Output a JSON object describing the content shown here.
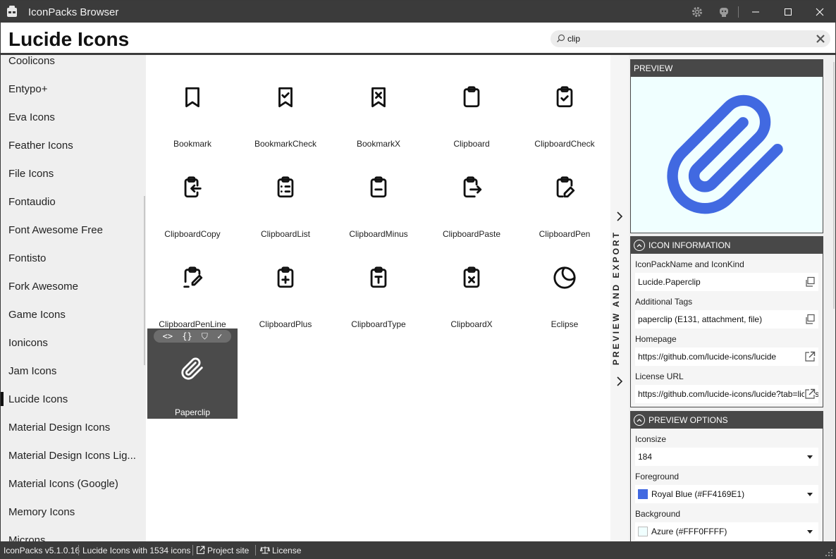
{
  "window": {
    "title": "IconPacks Browser"
  },
  "header": {
    "page_title": "Lucide Icons"
  },
  "search": {
    "value": "clip",
    "placeholder": ""
  },
  "sidebar": {
    "items": [
      {
        "label": "Coolicons"
      },
      {
        "label": "Entypo+"
      },
      {
        "label": "Eva Icons"
      },
      {
        "label": "Feather Icons"
      },
      {
        "label": "File Icons"
      },
      {
        "label": "Fontaudio"
      },
      {
        "label": "Font Awesome Free"
      },
      {
        "label": "Fontisto"
      },
      {
        "label": "Fork Awesome"
      },
      {
        "label": "Game Icons"
      },
      {
        "label": "Ionicons"
      },
      {
        "label": "Jam Icons"
      },
      {
        "label": "Lucide Icons",
        "active": true
      },
      {
        "label": "Material Design Icons"
      },
      {
        "label": "Material Design Icons Lig..."
      },
      {
        "label": "Material Icons (Google)"
      },
      {
        "label": "Memory Icons"
      },
      {
        "label": "Microns"
      }
    ]
  },
  "icons": [
    {
      "label": "Bookmark",
      "icon": "bookmark-icon"
    },
    {
      "label": "BookmarkCheck",
      "icon": "bookmark-check-icon"
    },
    {
      "label": "BookmarkX",
      "icon": "bookmark-x-icon"
    },
    {
      "label": "Clipboard",
      "icon": "clipboard-icon"
    },
    {
      "label": "ClipboardCheck",
      "icon": "clipboard-check-icon"
    },
    {
      "label": "ClipboardCopy",
      "icon": "clipboard-copy-icon"
    },
    {
      "label": "ClipboardList",
      "icon": "clipboard-list-icon"
    },
    {
      "label": "ClipboardMinus",
      "icon": "clipboard-minus-icon"
    },
    {
      "label": "ClipboardPaste",
      "icon": "clipboard-paste-icon"
    },
    {
      "label": "ClipboardPen",
      "icon": "clipboard-pen-icon"
    },
    {
      "label": "ClipboardPenLine",
      "icon": "clipboard-pen-line-icon"
    },
    {
      "label": "ClipboardPlus",
      "icon": "clipboard-plus-icon"
    },
    {
      "label": "ClipboardType",
      "icon": "clipboard-type-icon"
    },
    {
      "label": "ClipboardX",
      "icon": "clipboard-x-icon"
    },
    {
      "label": "Eclipse",
      "icon": "eclipse-icon"
    },
    {
      "label": "Paperclip",
      "icon": "paperclip-icon",
      "selected": true
    }
  ],
  "tile_tools": {
    "xaml": "<>",
    "json": "{}",
    "svg": "⛉",
    "copy": "✓"
  },
  "strip": {
    "label": "PREVIEW AND EXPORT"
  },
  "preview": {
    "header": "PREVIEW",
    "foreground": "#4169E1",
    "background": "#F0FFFF"
  },
  "icon_info": {
    "header": "ICON INFORMATION",
    "name_label": "IconPackName and IconKind",
    "name_value": "Lucide.Paperclip",
    "tags_label": "Additional Tags",
    "tags_value": "paperclip (E131, attachment, file)",
    "homepage_label": "Homepage",
    "homepage_value": "https://github.com/lucide-icons/lucide",
    "license_label": "License URL",
    "license_value": "https://github.com/lucide-icons/lucide?tab=license"
  },
  "preview_options": {
    "header": "PREVIEW OPTIONS",
    "iconsize_label": "Iconsize",
    "iconsize_value": "184",
    "foreground_label": "Foreground",
    "foreground_value": "Royal Blue (#FF4169E1)",
    "background_label": "Background",
    "background_value": "Azure (#FFF0FFFF)"
  },
  "statusbar": {
    "version": "IconPacks v5.1.0.16",
    "pack_info": "Lucide Icons with 1534 icons",
    "project_site": "Project site",
    "license": "License"
  }
}
